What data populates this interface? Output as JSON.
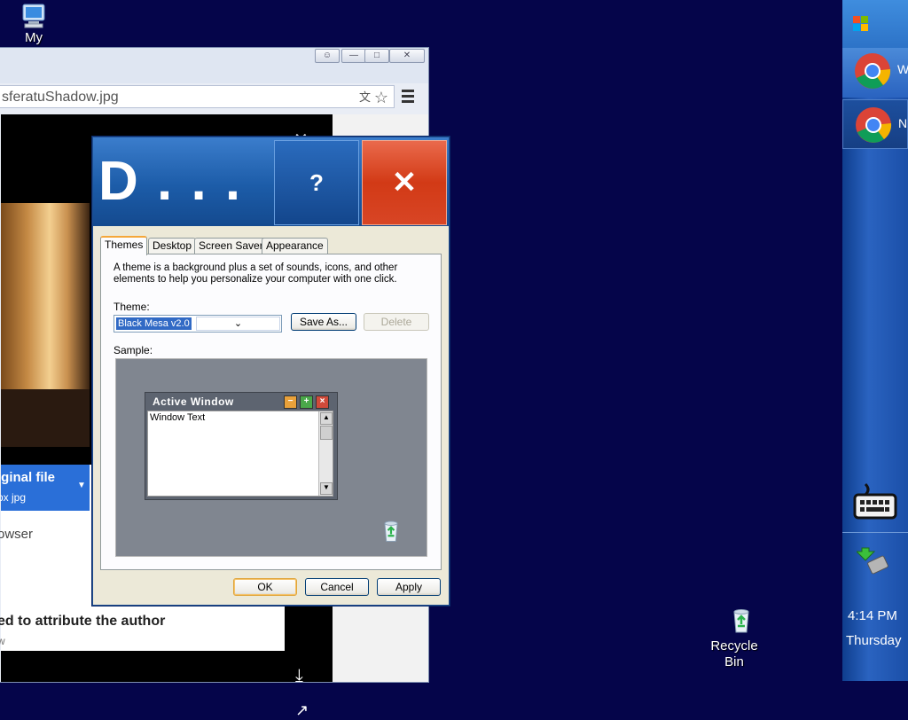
{
  "desktop": {
    "icons": [
      {
        "label": "My",
        "icon": "my-computer-icon"
      },
      {
        "label": "Recycle\nBin",
        "icon": "recycle-bin-icon"
      }
    ]
  },
  "browser": {
    "url_fragment": "sferatuShadow.jpg",
    "download_title": "iginal file",
    "download_sub": "px jpg",
    "open_in_text": "owser",
    "attribution_text": "ed to attribute the author",
    "attribution_sub": "w"
  },
  "dialog": {
    "title": "D . . .",
    "help_label": "?",
    "close_label": "✕",
    "tabs": [
      "Themes",
      "Desktop",
      "Screen Saver",
      "Appearance"
    ],
    "description": "A theme is a background plus a set of sounds, icons, and other elements to help you personalize your computer with one click.",
    "theme_label": "Theme:",
    "theme_value": "Black Mesa v2.0",
    "save_as_label": "Save As...",
    "delete_label": "Delete",
    "sample_label": "Sample:",
    "sample_window_title": "Active Window",
    "sample_window_text": "Window Text",
    "ok_label": "OK",
    "cancel_label": "Cancel",
    "apply_label": "Apply"
  },
  "taskbar": {
    "items": [
      {
        "label": "W",
        "icon": "chrome-icon"
      },
      {
        "label": "N",
        "icon": "chrome-icon"
      }
    ],
    "clock_time": "4:14 PM",
    "clock_day": "Thursday"
  }
}
